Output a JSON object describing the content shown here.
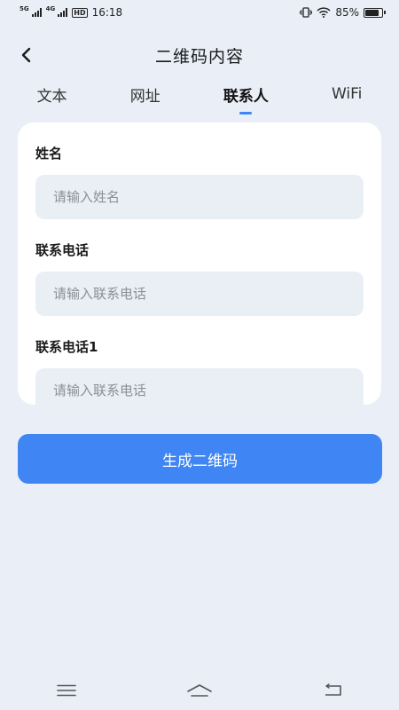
{
  "status_bar": {
    "network1": "5G",
    "network2": "4G",
    "hd": "HD",
    "time": "16:18",
    "battery": "85%",
    "battery_level": 0.85
  },
  "header": {
    "title": "二维码内容"
  },
  "tabs": [
    {
      "label": "文本"
    },
    {
      "label": "网址"
    },
    {
      "label": "联系人",
      "active": true
    },
    {
      "label": "WiFi"
    }
  ],
  "form": {
    "fields": [
      {
        "label": "姓名",
        "placeholder": "请输入姓名",
        "value": ""
      },
      {
        "label": "联系电话",
        "placeholder": "请输入联系电话",
        "value": ""
      },
      {
        "label": "联系电话1",
        "placeholder": "请输入联系电话",
        "value": ""
      }
    ]
  },
  "generate_button": {
    "label": "生成二维码"
  },
  "nav_bar": {
    "icons": [
      "menu-icon",
      "home-icon",
      "back-icon"
    ]
  },
  "colors": {
    "accent": "#3f86f4",
    "background": "#e9eef7",
    "card": "#ffffff",
    "input_bg": "#eaeff6"
  }
}
